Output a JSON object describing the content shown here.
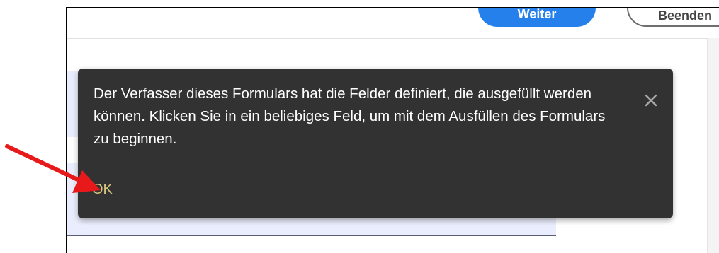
{
  "toolbar": {
    "primary_button_label": "Weiter",
    "secondary_button_label": "Beenden"
  },
  "tooltip": {
    "message": "Der Verfasser dieses Formulars hat die Felder definiert, die ausgefüllt werden können. Klicken Sie in ein beliebiges Feld, um mit dem Ausfüllen des Formulars zu beginnen.",
    "ok_label": "OK",
    "close_icon": "close-icon"
  },
  "annotation": {
    "arrow_color": "#e8191a"
  },
  "colors": {
    "tooltip_bg": "#323232",
    "ok_text": "#d5c47e",
    "primary_button": "#2680eb",
    "field_highlight": "#eaedfd"
  }
}
